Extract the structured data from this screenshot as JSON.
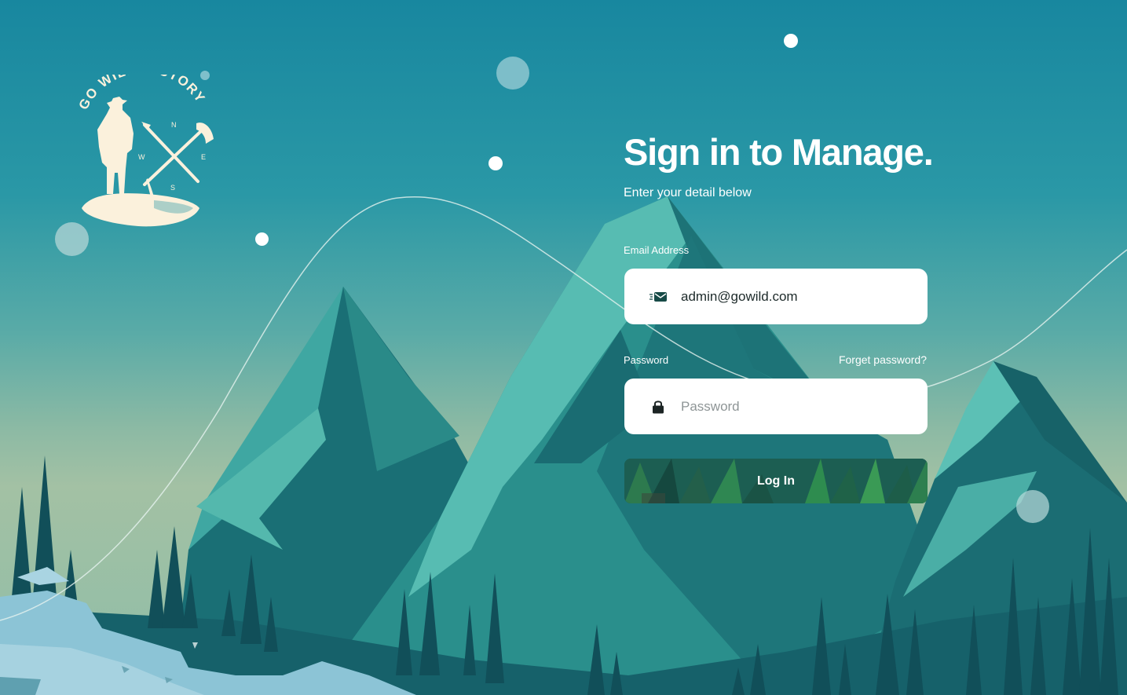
{
  "brand": {
    "name": "GO WILD HISTORY",
    "compass": {
      "north": "N",
      "east": "E",
      "south": "S",
      "west": "W"
    }
  },
  "login": {
    "title": "Sign in to Manage.",
    "subtitle": "Enter your detail below",
    "email": {
      "label": "Email Address",
      "value": "admin@gowild.com",
      "icon": "mail-icon"
    },
    "password": {
      "label": "Password",
      "placeholder": "Password",
      "value": "",
      "icon": "lock-icon"
    },
    "forgot_label": "Forget password?",
    "submit_label": "Log In"
  },
  "colors": {
    "sky_top": "#18879f",
    "sky_bottom": "#a3c1a4",
    "mountain_light": "#52b7ad",
    "mountain_dark": "#176a6f",
    "forest": "#0f4f59",
    "snow": "#8cc4d6",
    "button_green": "#1a5a4e",
    "logo_cream": "#fbf1dc"
  }
}
